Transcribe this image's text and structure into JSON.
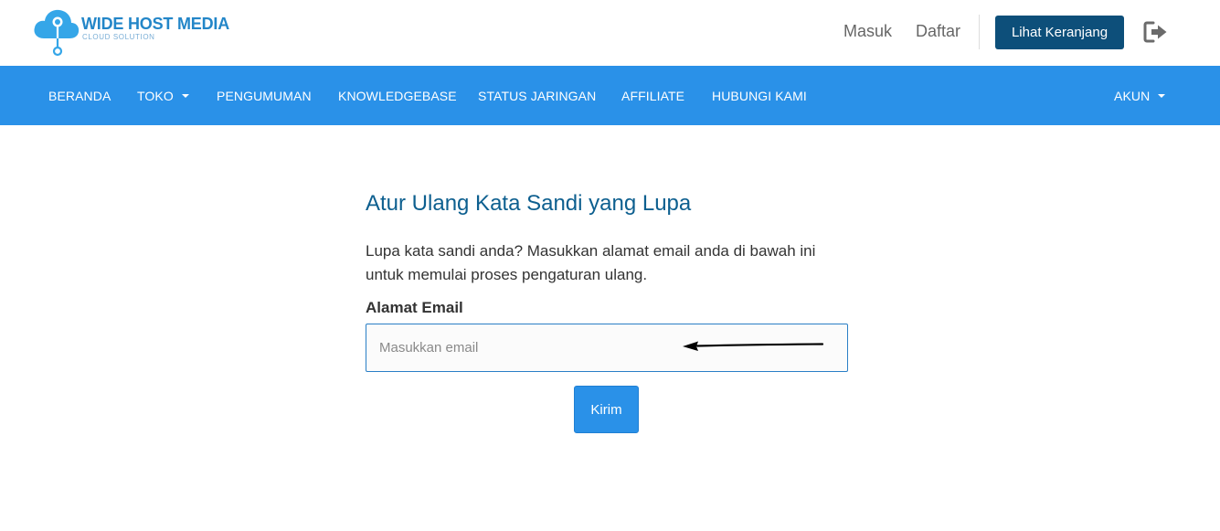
{
  "brand": {
    "name": "WIDE HOST MEDIA",
    "tagline": "CLOUD SOLUTION",
    "color": "#2386c8"
  },
  "header": {
    "login_label": "Masuk",
    "register_label": "Daftar",
    "cart_label": "Lihat Keranjang",
    "logout_icon": "logout-icon"
  },
  "nav": {
    "items": [
      {
        "label": "BERANDA",
        "has_dropdown": false
      },
      {
        "label": "TOKO",
        "has_dropdown": true
      },
      {
        "label": "PENGUMUMAN",
        "has_dropdown": false
      },
      {
        "label": "KNOWLEDGEBASE",
        "has_dropdown": false
      },
      {
        "label": "STATUS JARINGAN",
        "has_dropdown": false
      },
      {
        "label": "AFFILIATE",
        "has_dropdown": false
      },
      {
        "label": "HUBUNGI KAMI",
        "has_dropdown": false
      }
    ],
    "account_label": "AKUN",
    "background": "#2a91e8"
  },
  "form": {
    "title": "Atur Ulang Kata Sandi yang Lupa",
    "intro": "Lupa kata sandi anda? Masukkan alamat email anda di bawah ini untuk memulai proses pengaturan ulang.",
    "email_label": "Alamat Email",
    "email_placeholder": "Masukkan email",
    "email_value": "",
    "submit_label": "Kirim"
  },
  "colors": {
    "primary": "#2a91e8",
    "dark_button": "#0d4f7a",
    "title": "#0d5f8f"
  }
}
